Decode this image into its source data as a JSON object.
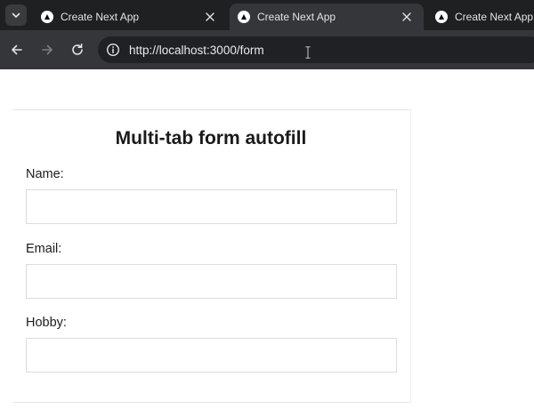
{
  "browser": {
    "tabs": [
      {
        "title": "Create Next App",
        "active": false
      },
      {
        "title": "Create Next App",
        "active": true
      },
      {
        "title": "Create Next App",
        "active": false
      }
    ],
    "address_bar": {
      "url": "http://localhost:3000/form"
    },
    "icons": {
      "tab_search": "chevron-down-icon",
      "favicon": "nextjs-triangle-icon",
      "close": "close-icon",
      "back": "arrow-left-icon",
      "forward": "arrow-right-icon",
      "reload": "reload-icon",
      "site_info": "info-icon"
    },
    "colors": {
      "tabstrip": "#1f2022",
      "toolbar": "#35363a",
      "omnibox": "#202124"
    }
  },
  "form": {
    "title": "Multi-tab form autofill",
    "fields": [
      {
        "label": "Name:",
        "value": ""
      },
      {
        "label": "Email:",
        "value": ""
      },
      {
        "label": "Hobby:",
        "value": ""
      }
    ]
  }
}
